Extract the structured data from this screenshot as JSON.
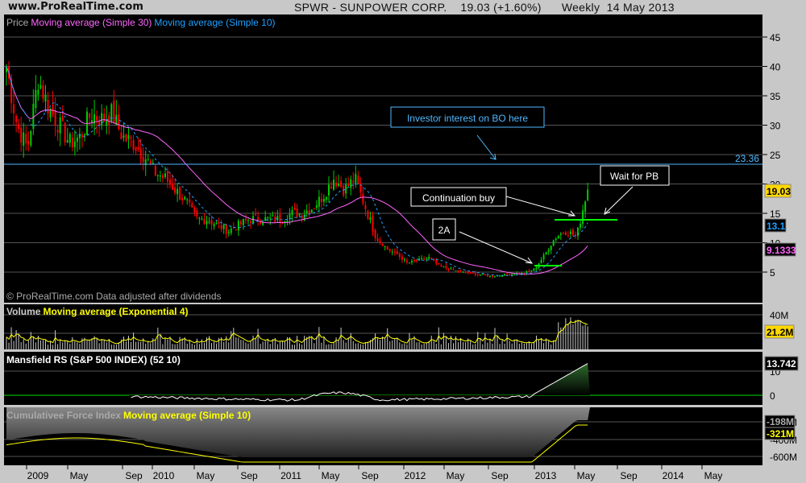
{
  "header": {
    "site": "www.ProRealTime.com",
    "title": "SPWR - SUNPOWER CORP.    19.03 (+1.60%)      Weekly  14 May 2013"
  },
  "price_panel": {
    "label_price": "Price",
    "label_ma30": "Moving average (Simple 30)",
    "label_ma10": "Moving average (Simple 10)",
    "copyright": "© ProRealTime.com  Data adjusted after dividends",
    "ticks": [
      "45",
      "40",
      "35",
      "30",
      "25",
      "20",
      "15",
      "10",
      "5"
    ],
    "level_label": "23.36",
    "last_price": "19.03",
    "last_ma10": "13.1",
    "last_ma30": "9.1333"
  },
  "volume_panel": {
    "label": "Volume",
    "label_ma": "Moving average (Exponential 4)",
    "ticks": [
      "40M",
      "20M"
    ],
    "last_volume": "21.2M"
  },
  "mansfield_panel": {
    "label": "Mansfield RS (S&P 500 INDEX) (52 10)",
    "ticks": [
      "10",
      "0"
    ],
    "last_value": "13.742"
  },
  "cfi_panel": {
    "label": "Cumulativee Force Index",
    "label_ma": "Moving average (Simple 10)",
    "ticks": [
      "-200M",
      "-400M",
      "-600M"
    ],
    "last_value": "-198M",
    "last_ma": "-321M"
  },
  "annotations": {
    "investor": "Investor interest on BO here",
    "continuation": "Continuation buy",
    "twoA": "2A",
    "wait": "Wait for PB"
  },
  "xaxis": [
    "2009",
    "May",
    "Sep",
    "2010",
    "May",
    "Sep",
    "2011",
    "May",
    "Sep",
    "2012",
    "May",
    "Sep",
    "2013",
    "May",
    "Sep",
    "2014",
    "May"
  ],
  "colors": {
    "up": "#00cc00",
    "down": "#ff0000",
    "ma30": "#ff66ff",
    "ma10": "#1ea0ff",
    "volume_ma": "#ffff00"
  },
  "chart_data": {
    "type": "line",
    "title": "SPWR - SUNPOWER CORP. Weekly",
    "x_start": "2008-10",
    "x_end": "2013-05",
    "ylabel": "Price",
    "ylim": [
      2,
      48
    ],
    "monthly_close": [
      40,
      30,
      26,
      38,
      33,
      30,
      27,
      28,
      32,
      31,
      32,
      28,
      27,
      25,
      22,
      21,
      19,
      17,
      14,
      14,
      13,
      12,
      13,
      14,
      14,
      14,
      14,
      15,
      15,
      16,
      18,
      21,
      19,
      21,
      16,
      11,
      9,
      8,
      6.5,
      7,
      7.5,
      6,
      5.5,
      5,
      4.8,
      4.5,
      4.3,
      4.5,
      4.7,
      4.8,
      5.5,
      8,
      11,
      12,
      11,
      19.03
    ],
    "horizontal_level": 23.36
  }
}
